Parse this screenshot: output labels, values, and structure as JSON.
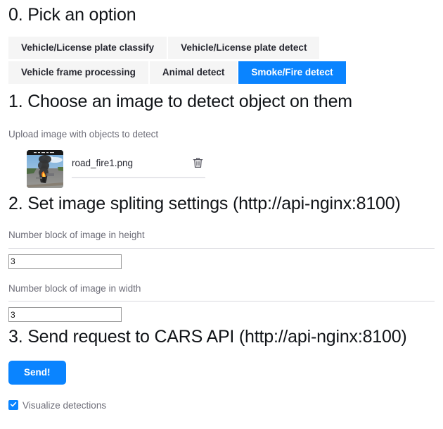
{
  "sections": {
    "pick_option": {
      "title": "0. Pick an option",
      "tabs": [
        {
          "label": "Vehicle/License plate classify",
          "active": false
        },
        {
          "label": "Vehicle/License plate detect",
          "active": false
        },
        {
          "label": "Vehicle frame processing",
          "active": false
        },
        {
          "label": "Animal detect",
          "active": false
        },
        {
          "label": "Smoke/Fire detect",
          "active": true
        }
      ]
    },
    "choose_image": {
      "title": "1. Choose an image to detect object on them",
      "caption": "Upload image with objects to detect",
      "file": {
        "name": "road_fire1.png",
        "thumbnail_alt": "dashcam-road-fire-thumbnail",
        "delete_icon": "trash-icon"
      }
    },
    "split_settings": {
      "title": "2. Set image spliting settings (http://api-nginx:8100)",
      "fields": [
        {
          "label": "Number block of image in height",
          "value": "3"
        },
        {
          "label": "Number block of image in width",
          "value": "3"
        }
      ]
    },
    "send_request": {
      "title": "3. Send request to CARS API (http://api-nginx:8100)",
      "send_label": "Send!",
      "checkbox": {
        "label": "Visualize detections",
        "checked": true
      }
    }
  },
  "colors": {
    "accent": "#0a84ff",
    "tab_inactive_bg": "#f5f5f5",
    "muted_text": "#6d6d78",
    "heading_text": "#111418"
  }
}
